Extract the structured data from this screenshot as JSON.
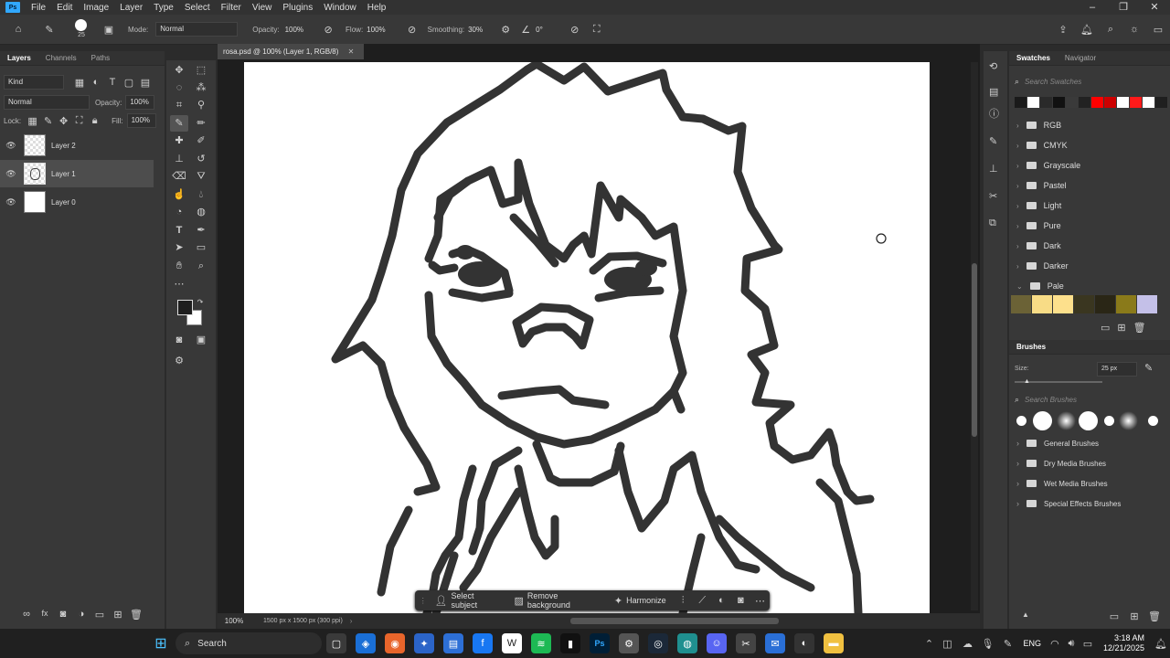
{
  "app": {
    "logo": "Ps"
  },
  "menu": [
    "File",
    "Edit",
    "Image",
    "Layer",
    "Type",
    "Select",
    "Filter",
    "View",
    "Plugins",
    "Window",
    "Help"
  ],
  "window_controls": {
    "minimize": "–",
    "restore": "❐",
    "close": "✕"
  },
  "options": {
    "brush_size": "25",
    "mode_label": "Mode:",
    "mode_value": "Normal",
    "opacity_label": "Opacity:",
    "opacity_value": "100%",
    "flow_label": "Flow:",
    "flow_value": "100%",
    "smoothing_label": "Smoothing:",
    "smoothing_value": "30%",
    "angle_value": "0°"
  },
  "layers_panel": {
    "tabs": [
      "Layers",
      "Channels",
      "Paths"
    ],
    "filter": "Kind",
    "blend_mode": "Normal",
    "opacity_label": "Opacity:",
    "opacity_value": "100%",
    "lock_label": "Lock:",
    "fill_label": "Fill:",
    "fill_value": "100%",
    "layers": [
      "Layer 2",
      "Layer 1",
      "Layer 0"
    ],
    "selected_layer": "Layer 1"
  },
  "document": {
    "tab_title": "rosa.psd @ 100% (Layer 1, RGB/8)",
    "zoom": "100%",
    "info": "1500 px x 1500 px (300 ppi)"
  },
  "context_bar": {
    "select_subject": "Select subject",
    "remove_background": "Remove background",
    "harmonize": "Harmonize"
  },
  "swatches_panel": {
    "tabs": [
      "Swatches",
      "Navigator"
    ],
    "search_placeholder": "Search Swatches",
    "recent_colors": [
      "#1a1a1a",
      "#ffffff",
      "#2a2a2a",
      "#111111",
      "#3a3a3a",
      "#222222",
      "#ff0000",
      "#cc0000",
      "#ffffff",
      "#ff1a1a",
      "#ffffff",
      "#1f1f1f"
    ],
    "groups": [
      "RGB",
      "CMYK",
      "Grayscale",
      "Pastel",
      "Light",
      "Pure",
      "Dark",
      "Darker",
      "Pale"
    ],
    "pale_colors": [
      "#6b6236",
      "#f8dc86",
      "#fde08c",
      "#3a3620",
      "#2a2616",
      "#8a7a1a",
      "#c4c0e8"
    ]
  },
  "brushes_panel": {
    "title": "Brushes",
    "size_label": "Size:",
    "size_value": "25 px",
    "search_placeholder": "Search Brushes",
    "groups": [
      "General Brushes",
      "Dry Media Brushes",
      "Wet Media Brushes",
      "Special Effects Brushes"
    ]
  },
  "taskbar": {
    "search_label": "Search",
    "tray_lang": "ENG",
    "time": "3:18 AM",
    "date": "12/21/2025"
  },
  "colors": {
    "accent": "#31a8ff",
    "foreground_color": "#1f1f1f",
    "background_color": "#ffffff"
  }
}
